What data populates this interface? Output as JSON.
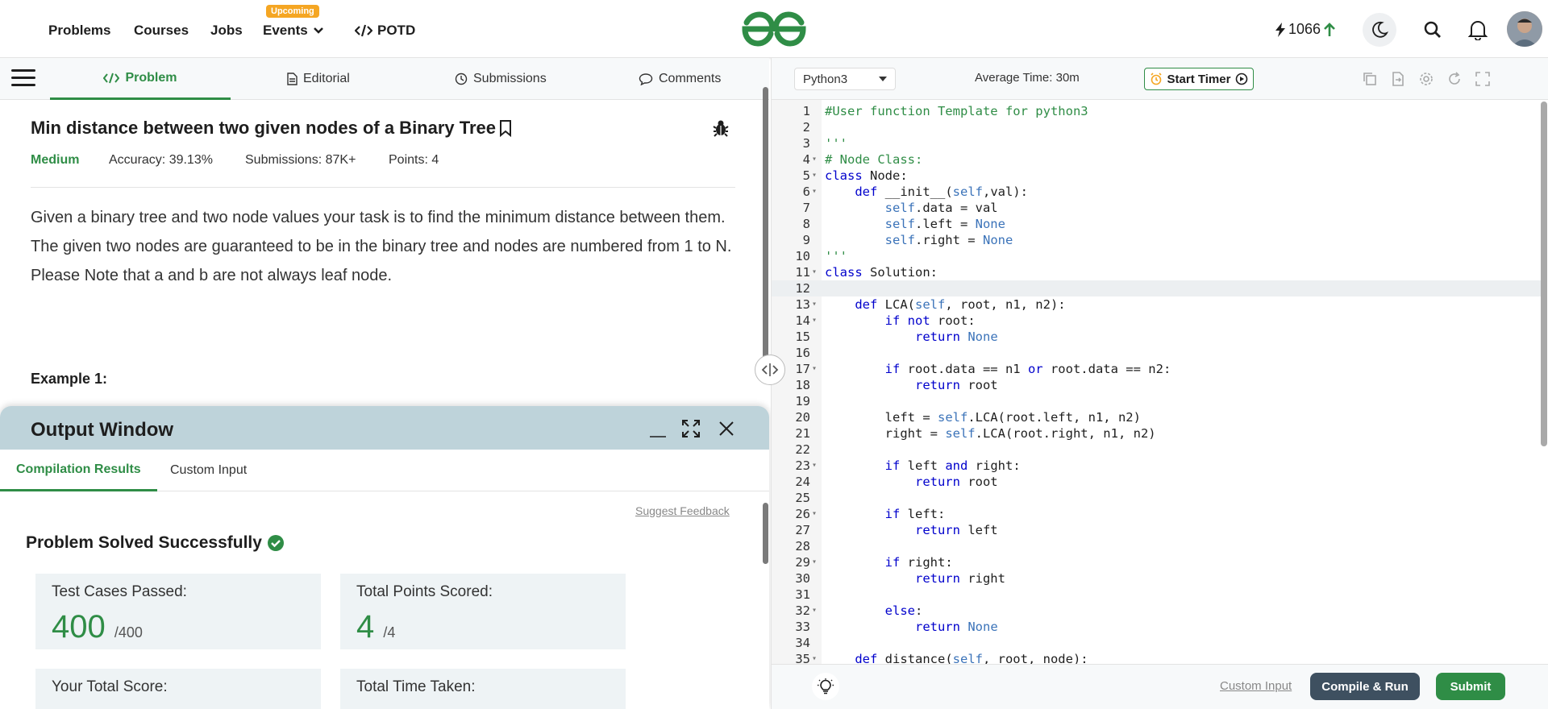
{
  "nav": {
    "items": [
      "Problems",
      "Courses",
      "Jobs",
      "Events"
    ],
    "events_badge": "Upcoming",
    "potd": "POTD",
    "streak": "1066"
  },
  "problem_tabs": [
    "Problem",
    "Editorial",
    "Submissions",
    "Comments"
  ],
  "problem": {
    "title": "Min distance between two given nodes of a Binary Tree",
    "difficulty": "Medium",
    "accuracy": "Accuracy: 39.13%",
    "submissions": "Submissions: 87K+",
    "points": "Points: 4",
    "description": [
      "Given a binary tree and two node values your task is to find the minimum distance between them.",
      "The given two nodes are guaranteed to be in the binary tree and nodes are numbered from 1 to N.",
      "Please Note that a and b are not always leaf node."
    ],
    "example_heading": "Example 1:"
  },
  "output": {
    "title": "Output Window",
    "tabs": [
      "Compilation Results",
      "Custom Input"
    ],
    "feedback": "Suggest Feedback",
    "status": "Problem Solved Successfully",
    "cards": [
      {
        "label": "Test Cases Passed:",
        "value": "400",
        "total": "/400"
      },
      {
        "label": "Total Points Scored:",
        "value": "4",
        "total": "/4"
      },
      {
        "label": "Your Total Score:",
        "value": "",
        "total": ""
      },
      {
        "label": "Total Time Taken:",
        "value": "",
        "total": ""
      }
    ]
  },
  "editor": {
    "language": "Python3",
    "avg_time": "Average Time: 30m",
    "start_timer": "Start Timer",
    "custom_input": "Custom Input",
    "compile_run": "Compile & Run",
    "submit": "Submit",
    "lines": [
      "#User function Template for python3",
      "",
      "'''",
      "# Node Class:",
      "class Node:",
      "    def __init__(self,val):",
      "        self.data = val",
      "        self.left = None",
      "        self.right = None",
      "'''",
      "class Solution:",
      "",
      "    def LCA(self, root, n1, n2):",
      "        if not root:",
      "            return None",
      "",
      "        if root.data == n1 or root.data == n2:",
      "            return root",
      "",
      "        left = self.LCA(root.left, n1, n2)",
      "        right = self.LCA(root.right, n1, n2)",
      "",
      "        if left and right:",
      "            return root",
      "",
      "        if left:",
      "            return left",
      "",
      "        if right:",
      "            return right",
      "",
      "        else:",
      "            return None",
      "",
      "    def distance(self, root, node):"
    ],
    "folded_lines": [
      4,
      5,
      6,
      11,
      13,
      14,
      17,
      23,
      26,
      29,
      32,
      35
    ],
    "active_line": 12
  },
  "colors": {
    "accent": "#2f8d46",
    "run_button": "#3e5060",
    "output_header": "#bed3da"
  }
}
